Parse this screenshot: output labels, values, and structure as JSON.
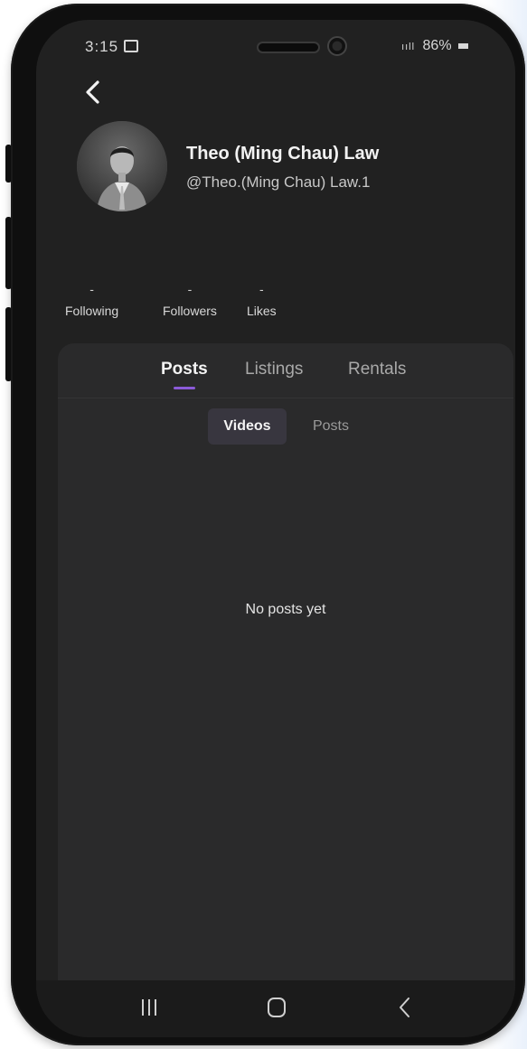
{
  "status_bar": {
    "time": "3:15",
    "signal": "ııll",
    "battery": "86%"
  },
  "profile": {
    "name": "Theo (Ming Chau) Law",
    "handle": "@Theo.(Ming Chau) Law.1"
  },
  "stats": [
    {
      "value": "-",
      "label": "Following"
    },
    {
      "value": "-",
      "label": "Followers"
    },
    {
      "value": "-",
      "label": "Likes"
    }
  ],
  "tabs": [
    {
      "label": "Posts",
      "active": true
    },
    {
      "label": "Listings",
      "active": false
    },
    {
      "label": "Rentals",
      "active": false
    }
  ],
  "sub_tabs": [
    {
      "label": "Videos",
      "active": true
    },
    {
      "label": "Posts",
      "active": false
    }
  ],
  "empty_state": "No posts yet",
  "icons": {
    "back": "chevron-left-icon",
    "recents": "recents-icon",
    "home": "home-icon",
    "nav_back": "nav-back-icon"
  },
  "colors": {
    "background": "#212121",
    "panel": "#2a2a2b",
    "accent": "#8c5bd9"
  }
}
